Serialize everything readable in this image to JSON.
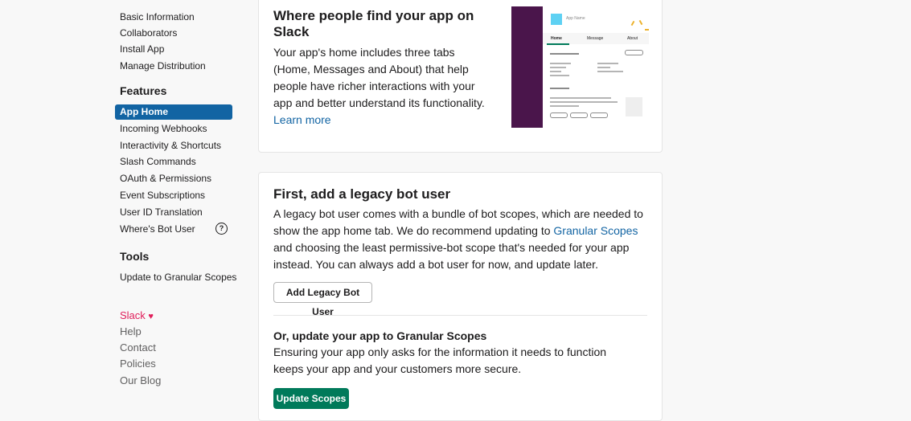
{
  "sidebar": {
    "settings_items": [
      {
        "label": "Basic Information"
      },
      {
        "label": "Collaborators"
      },
      {
        "label": "Install App"
      },
      {
        "label": "Manage Distribution"
      }
    ],
    "features_heading": "Features",
    "features_items": [
      {
        "label": "App Home",
        "active": true
      },
      {
        "label": "Incoming Webhooks"
      },
      {
        "label": "Interactivity & Shortcuts"
      },
      {
        "label": "Slash Commands"
      },
      {
        "label": "OAuth & Permissions"
      },
      {
        "label": "Event Subscriptions"
      },
      {
        "label": "User ID Translation"
      },
      {
        "label": "Where's Bot User"
      }
    ],
    "help_icon": "question-circle-icon",
    "help_glyph": "?",
    "tools_heading": "Tools",
    "tools_items": [
      {
        "label": "Update to Granular Scopes"
      }
    ],
    "footer": {
      "slack": "Slack",
      "heart": "♥",
      "help": "Help",
      "contact": "Contact",
      "policies": "Policies",
      "blog": "Our Blog"
    }
  },
  "app_home_card": {
    "title": "Where people find your app on Slack",
    "description": "Your app's home includes three tabs (Home, Messages and About) that help people have richer interactions with your app and better understand its functionality.",
    "learn_more": "Learn more",
    "illustration": {
      "app_name": "App Name",
      "tabs": [
        "Home",
        "Message",
        "About"
      ]
    }
  },
  "legacy_card": {
    "title": "First, add a legacy bot user",
    "description_before_link": "A legacy bot user comes with a bundle of bot scopes, which are needed to show the app home tab. We do recommend updating to ",
    "link": "Granular Scopes",
    "description_after_link": " and choosing the least permissive-bot scope that's needed for your app instead. You can always add a bot user for now, and update later.",
    "add_button": "Add Legacy Bot User",
    "update_heading": "Or, update your app to Granular Scopes",
    "update_description": "Ensuring your app only asks for the information it needs to function keeps your app and your customers more secure.",
    "update_button": "Update Scopes"
  },
  "colors": {
    "active_nav": "#1264a3",
    "link": "#1264a3",
    "primary_button": "#007a5a",
    "slack_aubergine": "#4a154b",
    "heart": "#e01e5a"
  }
}
